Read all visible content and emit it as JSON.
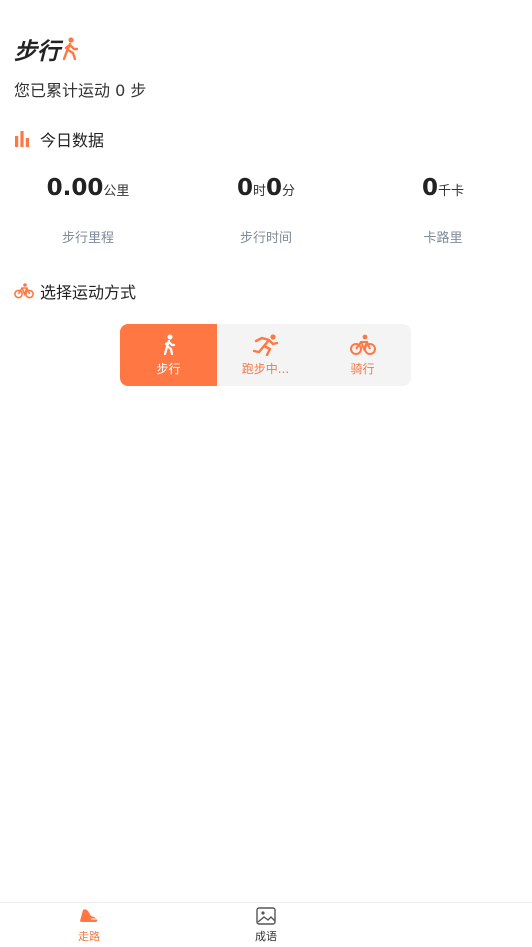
{
  "header": {
    "title": "步行",
    "title_icon": "walking-person-icon"
  },
  "summary": {
    "text": "您已累计运动 0 步"
  },
  "stats": {
    "section_title": "今日数据",
    "distance": {
      "value": "0.00",
      "unit": "公里",
      "label": "步行里程"
    },
    "time": {
      "hours": "0",
      "hours_unit": "时",
      "minutes": "0",
      "minutes_unit": "分",
      "label": "步行时间"
    },
    "calories": {
      "value": "0",
      "unit": "千卡",
      "label": "卡路里"
    }
  },
  "mode_section": {
    "title": "选择运动方式",
    "modes": [
      {
        "label": "步行",
        "icon": "walking-icon",
        "active": true
      },
      {
        "label": "跑步中...",
        "icon": "running-icon",
        "active": false
      },
      {
        "label": "骑行",
        "icon": "cycling-icon",
        "active": false
      }
    ]
  },
  "tabbar": {
    "items": [
      {
        "label": "走路",
        "icon": "shoe-icon",
        "active": true
      },
      {
        "label": "成语",
        "icon": "image-icon",
        "active": false
      }
    ]
  },
  "colors": {
    "accent": "#ff7843",
    "label_gray": "#7f8a99",
    "segment_bg": "#f4f4f4"
  }
}
